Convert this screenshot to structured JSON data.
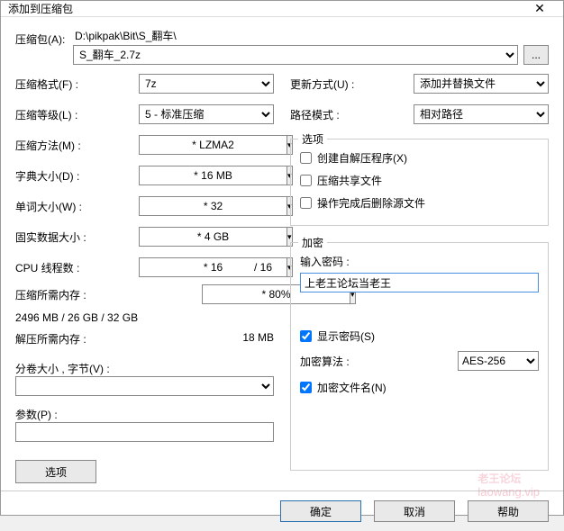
{
  "window": {
    "title": "添加到压缩包"
  },
  "archive": {
    "label": "压缩包(A):",
    "path_text": "D:\\pikpak\\Bit\\S_翻车\\",
    "filename": "S_翻车_2.7z",
    "browse": "..."
  },
  "left": {
    "format": {
      "label": "压缩格式(F) :",
      "value": "7z"
    },
    "level": {
      "label": "压缩等级(L) :",
      "value": "5 - 标准压缩"
    },
    "method": {
      "label": "压缩方法(M) :",
      "value": "LZMA2",
      "starred": "* LZMA2"
    },
    "dict": {
      "label": "字典大小(D) :",
      "value": "16 MB",
      "starred": "* 16 MB"
    },
    "word": {
      "label": "单词大小(W) :",
      "value": "32",
      "starred": "* 32"
    },
    "solid": {
      "label": "固实数据大小 :",
      "value": "4 GB",
      "starred": "* 4 GB"
    },
    "cpu": {
      "label": "CPU 线程数 :",
      "value": "16",
      "starred": "* 16",
      "total": "/ 16"
    },
    "mem_comp": {
      "label": "压缩所需内存 :",
      "value": "80%",
      "starred": "* 80%",
      "sub": "2496 MB / 26 GB / 32 GB"
    },
    "mem_decomp": {
      "label": "解压所需内存 :",
      "value": "18 MB"
    },
    "volume": {
      "label": "分卷大小 , 字节(V) :",
      "value": ""
    },
    "params": {
      "label": "参数(P) :",
      "value": ""
    },
    "options_btn": "选项"
  },
  "right": {
    "update": {
      "label": "更新方式(U) :",
      "value": "添加并替换文件"
    },
    "pathmode": {
      "label": "路径模式 :",
      "value": "相对路径"
    },
    "options": {
      "legend": "选项",
      "sfx": {
        "label": "创建自解压程序(X)",
        "checked": false
      },
      "shared": {
        "label": "压缩共享文件",
        "checked": false
      },
      "delete": {
        "label": "操作完成后删除源文件",
        "checked": false
      }
    },
    "encrypt": {
      "legend": "加密",
      "password_label": "输入密码 :",
      "password_value": "上老王论坛当老王",
      "show_password": {
        "label": "显示密码(S)",
        "checked": true
      },
      "algo": {
        "label": "加密算法 :",
        "value": "AES-256"
      },
      "encrypt_names": {
        "label": "加密文件名(N)",
        "checked": true
      }
    }
  },
  "footer": {
    "ok": "确定",
    "cancel": "取消",
    "help": "帮助"
  },
  "watermark": {
    "main": "老王论坛",
    "url": "laowang.vip"
  }
}
